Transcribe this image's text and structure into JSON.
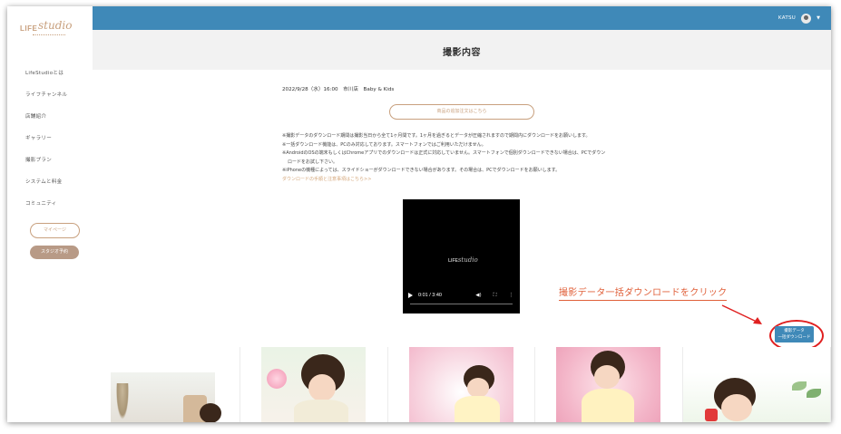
{
  "sidebar": {
    "logo": {
      "word": "LIFE",
      "script": "studio"
    },
    "items": [
      {
        "label": "LifeStudioとは"
      },
      {
        "label": "ライフチャンネル"
      },
      {
        "label": "店舗紹介"
      },
      {
        "label": "ギャラリー"
      },
      {
        "label": "撮影プラン"
      },
      {
        "label": "システムと料金"
      },
      {
        "label": "コミュニティ"
      }
    ],
    "mypage_label": "マイページ",
    "studio_label": "スタジオ予約"
  },
  "topbar": {
    "username": "KATSU",
    "color": "#3f89b8"
  },
  "header": {
    "title": "撮影内容"
  },
  "main": {
    "session_info": "2022/9/28（水）16:00　市川店　Baby & Kids",
    "order_button": "商品の追加注文はこちら",
    "notes": [
      "※撮影データのダウンロード期間は撮影当日から全て1ヶ月間です。1ヶ月を過ぎるとデータが圧縮されますので期間内にダウンロードをお願いします。",
      "※一括ダウンロード機能は、PCのみ対応しております。スマートフォンではご利用いただけません。",
      "※AndroidのOSの端末もしくはChromeアプリでのダウンロードは正式に対応していません。スマートフォンで個別ダウンロードできない場合は、PCでダウン",
      "ロードをお試し下さい。",
      "※iPhoneの機種によっては、スライドショーがダウンロードできない場合があります。その場合は、PCでダウンロードをお願いします。"
    ],
    "notes_link": "ダウンロードの手順と注意事項はこちら>>",
    "video": {
      "logo_word": "LIFE",
      "logo_script": "studio",
      "time": "0:01 / 3:40",
      "progress": 0.005
    },
    "annotation": "撮影データ一括ダウンロードをクリック",
    "download_button": {
      "line1": "撮影データ",
      "line2": "一括ダウンロード"
    }
  },
  "colors": {
    "accent": "#c8a07e",
    "primary": "#3f89b8",
    "annotation": "#e0603a",
    "highlight": "#e02020"
  }
}
